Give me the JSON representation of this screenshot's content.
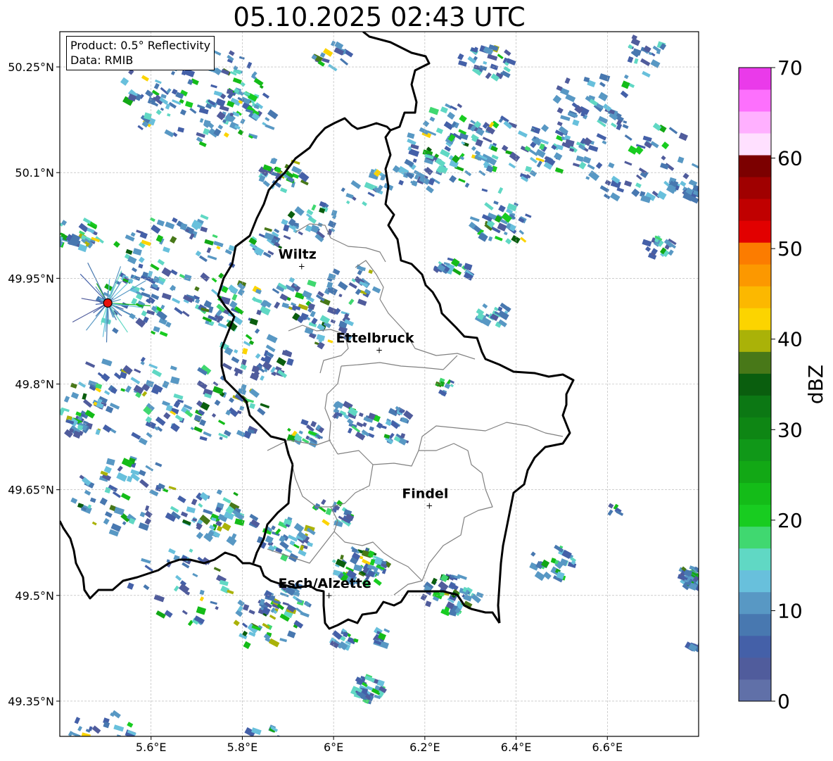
{
  "title": "05.10.2025 02:43 UTC",
  "info_box": {
    "product": "Product: 0.5° Reflectivity",
    "data": "Data: RMIB"
  },
  "map": {
    "lon_range": [
      5.4,
      6.8
    ],
    "lat_range": [
      49.3,
      50.3
    ],
    "x_ticks": [
      {
        "value": 5.6,
        "label": "5.6°E"
      },
      {
        "value": 5.8,
        "label": "5.8°E"
      },
      {
        "value": 6.0,
        "label": "6°E"
      },
      {
        "value": 6.2,
        "label": "6.2°E"
      },
      {
        "value": 6.4,
        "label": "6.4°E"
      },
      {
        "value": 6.6,
        "label": "6.6°E"
      }
    ],
    "y_ticks": [
      {
        "value": 49.35,
        "label": "49.35°N"
      },
      {
        "value": 49.5,
        "label": "49.5°N"
      },
      {
        "value": 49.65,
        "label": "49.65°N"
      },
      {
        "value": 49.8,
        "label": "49.8°N"
      },
      {
        "value": 49.95,
        "label": "49.95°N"
      },
      {
        "value": 50.1,
        "label": "50.1°N"
      },
      {
        "value": 50.25,
        "label": "50.25°N"
      }
    ],
    "grid": true,
    "cities": [
      {
        "name": "Wiltz",
        "lon": 5.93,
        "lat": 49.967
      },
      {
        "name": "Ettelbruck",
        "lon": 6.1,
        "lat": 49.848
      },
      {
        "name": "Findel",
        "lon": 6.21,
        "lat": 49.627
      },
      {
        "name": "Esch/Alzette",
        "lon": 5.99,
        "lat": 49.5
      }
    ],
    "radar_site": {
      "lon": 5.505,
      "lat": 49.915,
      "color": "#e8120c"
    }
  },
  "colorbar": {
    "label": "dBZ",
    "min": 0,
    "max": 70,
    "step": 2.5,
    "ticks": [
      0,
      10,
      20,
      30,
      40,
      50,
      60,
      70
    ],
    "colors": [
      "#6070a8",
      "#505c9c",
      "#4460a8",
      "#4878b0",
      "#5898c4",
      "#68c0dc",
      "#60d8c4",
      "#40d870",
      "#18cc20",
      "#14bc18",
      "#12a815",
      "#109818",
      "#0e8614",
      "#0c7814",
      "#0a5e0e",
      "#487818",
      "#aab208",
      "#fcd400",
      "#fcb800",
      "#fc9800",
      "#fc7c00",
      "#e20000",
      "#c00000",
      "#a00000",
      "#7c0000",
      "#ffe0ff",
      "#ffb0ff",
      "#fd70fd",
      "#ea3aea"
    ]
  }
}
